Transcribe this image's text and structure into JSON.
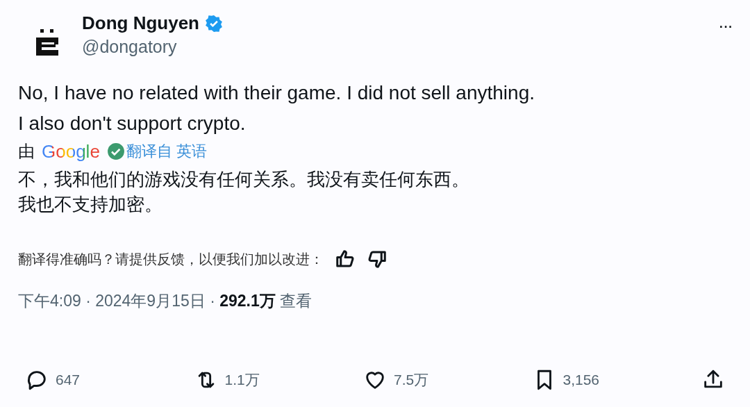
{
  "author": {
    "name": "Dong Nguyen",
    "verified": true,
    "handle": "@dongatory"
  },
  "more_button": "···",
  "text": [
    "No, I have no related with their game. I did not sell anything.",
    "I also don't support crypto."
  ],
  "translation": {
    "by": "由",
    "provider": "Google",
    "label": "翻译自 英语",
    "lines": [
      "不，我和他们的游戏没有任何关系。我没有卖任何东西。",
      "我也不支持加密。"
    ]
  },
  "feedback": {
    "prompt": "翻译得准确吗？请提供反馈，以便我们加以改进："
  },
  "meta": {
    "time": "下午4:09 · 2024年9月15日 · ",
    "views": "292.1万",
    "views_label": "查看"
  },
  "actions": [
    {
      "kind": "reply",
      "count": "647"
    },
    {
      "kind": "retweet",
      "count": "1.1万"
    },
    {
      "kind": "like",
      "count": "7.5万"
    },
    {
      "kind": "bookmark",
      "count": "3,156"
    },
    {
      "kind": "share"
    }
  ]
}
